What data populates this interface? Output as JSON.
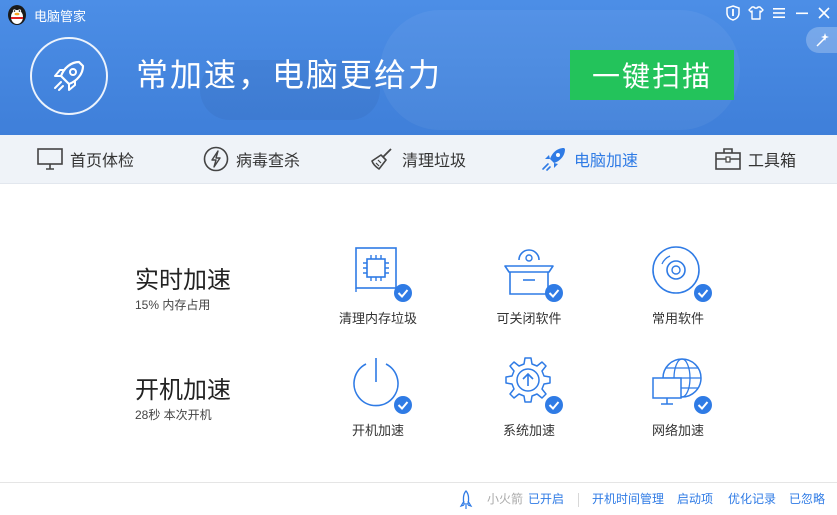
{
  "app": {
    "title": "电脑管家"
  },
  "header": {
    "slogan": "常加速，电脑更给力",
    "scan_button": "一键扫描"
  },
  "tabs": [
    {
      "label": "首页体检",
      "icon": "monitor-icon"
    },
    {
      "label": "病毒查杀",
      "icon": "lightning-icon"
    },
    {
      "label": "清理垃圾",
      "icon": "broom-icon"
    },
    {
      "label": "电脑加速",
      "icon": "rocket-icon",
      "active": true
    },
    {
      "label": "工具箱",
      "icon": "toolbox-icon"
    }
  ],
  "realtime": {
    "title": "实时加速",
    "subtitle": "15% 内存占用",
    "items": [
      {
        "label": "清理内存垃圾",
        "icon": "memory-chip-icon"
      },
      {
        "label": "可关闭软件",
        "icon": "open-box-icon"
      },
      {
        "label": "常用软件",
        "icon": "disc-icon"
      }
    ]
  },
  "startup": {
    "title": "开机加速",
    "subtitle": "28秒 本次开机",
    "items": [
      {
        "label": "开机加速",
        "icon": "power-icon"
      },
      {
        "label": "系统加速",
        "icon": "gear-icon"
      },
      {
        "label": "网络加速",
        "icon": "network-globe-icon"
      }
    ]
  },
  "footer": {
    "rocket_label": "小火箭",
    "rocket_status": "已开启",
    "links": [
      "开机时间管理",
      "启动项",
      "优化记录",
      "已忽略"
    ]
  },
  "colors": {
    "header_blue": "#4588e2",
    "scan_green": "#23c35b",
    "accent": "#2f7be5",
    "check": "#2f7be5"
  }
}
